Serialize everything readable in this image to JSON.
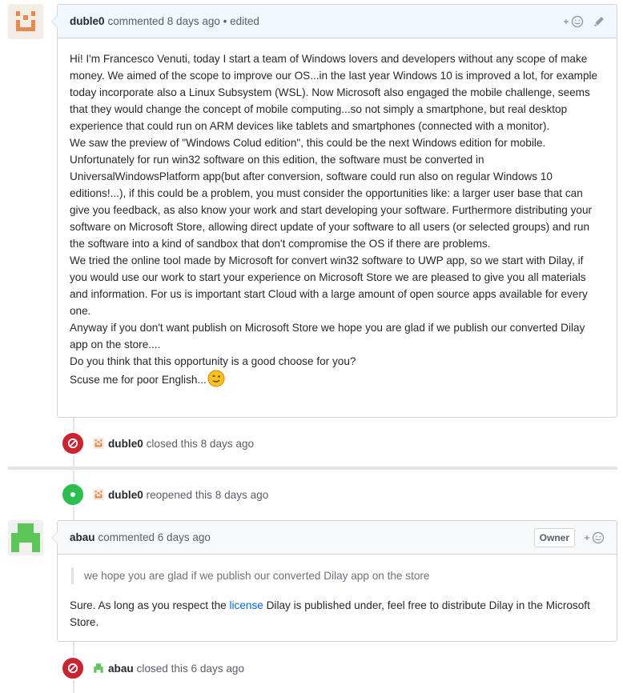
{
  "comment1": {
    "author": "duble0",
    "meta": "commented 8 days ago • edited",
    "paragraphs": [
      "Hi! I'm Francesco Venuti, today I start a team of Windows lovers and developers without any scope of make money. We aimed of the scope to improve our OS...in the last year Windows 10 is improved a lot, for example today incorporate also a Linux Subsystem (WSL). Now Microsoft also engaged the mobile challenge, seems that they would change the concept of mobile computing...so not simply a smartphone, but real desktop experience that could run on ARM devices like tablets and smartphones (connected with a monitor).",
      "We saw the preview of \"Windows Colud edition\", this could be the next Windows edition for mobile. Unfortunately for run win32 software on this edition, the software must be converted in UniversalWindowsPlatform app(but after conversion, software could run also on regular Windows 10 editions!...), if this could be a problem, you must consider the opportunities like: a larger user base that can give you feedback, as also know your work and start developing your software. Furthermore distributing your software on Microsoft Store, allowing direct update of your software to all users (or selected groups) and run the software into a kind of sandbox that don't compromise the OS if there are problems.",
      "We tried the online tool made by Microsoft for convert win32 software to UWP app, so we start with Dilay, if you would use our work to start your experience on Microsoft Store we are pleased to give you all materials and information. For us is important start Cloud with a large amount of open source apps available for every one.",
      "Anyway if you don't want publish on Microsoft Store we hope you are glad if we publish our converted Dilay app on the store....",
      "Do you think that this opportunity is a good choose for you?",
      "Scuse me for poor English..."
    ]
  },
  "event1": {
    "actor": "duble0",
    "action": "closed this 8 days ago"
  },
  "event2": {
    "actor": "duble0",
    "action": "reopened this 8 days ago"
  },
  "comment2": {
    "author": "abau",
    "meta": "commented 6 days ago",
    "owner_label": "Owner",
    "quote": "we hope you are glad if we publish our converted Dilay app on the store",
    "reply_before": "Sure. As long as you respect the ",
    "reply_link": "license",
    "reply_after": " Dilay is published under, feel free to distribute Dilay in the Microsoft Store."
  },
  "event3": {
    "actor": "abau",
    "action": "closed this 6 days ago"
  },
  "colors": {
    "closed": "#cb2431",
    "reopened": "#2cbe4e",
    "link": "#0366d6",
    "header_blue": "#f1f8ff"
  },
  "icons": {
    "add_reaction": "smiley-plus-icon",
    "edit": "pencil-icon",
    "closed": "circle-slash-icon",
    "reopened": "dot-fill-icon"
  }
}
